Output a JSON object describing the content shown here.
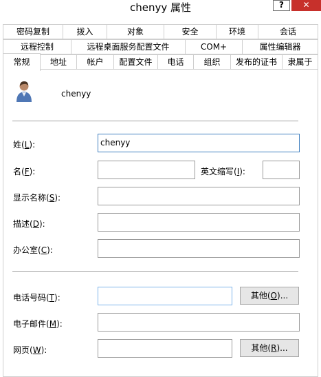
{
  "window": {
    "title": "chenyy 属性",
    "help_glyph": "?",
    "close_glyph": "✕"
  },
  "tabs": {
    "row1": [
      "密码复制",
      "拨入",
      "对象",
      "安全",
      "环境",
      "会话"
    ],
    "row2": [
      "远程控制",
      "远程桌面服务配置文件",
      "COM+",
      "属性编辑器"
    ],
    "row3": [
      "常规",
      "地址",
      "帐户",
      "配置文件",
      "电话",
      "组织",
      "发布的证书",
      "隶属于"
    ]
  },
  "general": {
    "username": "chenyy",
    "last_name": {
      "label": "姓",
      "key": "L",
      "value": "chenyy"
    },
    "first_name": {
      "label": "名",
      "key": "F",
      "value": ""
    },
    "initials": {
      "label": "英文缩写",
      "key": "I",
      "value": ""
    },
    "display_name": {
      "label": "显示名称",
      "key": "S",
      "value": ""
    },
    "description": {
      "label": "描述",
      "key": "D",
      "value": ""
    },
    "office": {
      "label": "办公室",
      "key": "C",
      "value": ""
    },
    "telephone": {
      "label": "电话号码",
      "key": "T",
      "value": ""
    },
    "email": {
      "label": "电子邮件",
      "key": "M",
      "value": ""
    },
    "webpage": {
      "label": "网页",
      "key": "W",
      "value": ""
    },
    "other_phone_button": {
      "label": "其他",
      "key": "O",
      "suffix": "..."
    },
    "other_web_button": {
      "label": "其他",
      "key": "R",
      "suffix": "..."
    }
  },
  "colors": {
    "close_button": "#c7302b",
    "focus_border": "#3f7fbf",
    "button_face": "#e6e6e6"
  },
  "icons": {
    "user": "user-icon"
  }
}
